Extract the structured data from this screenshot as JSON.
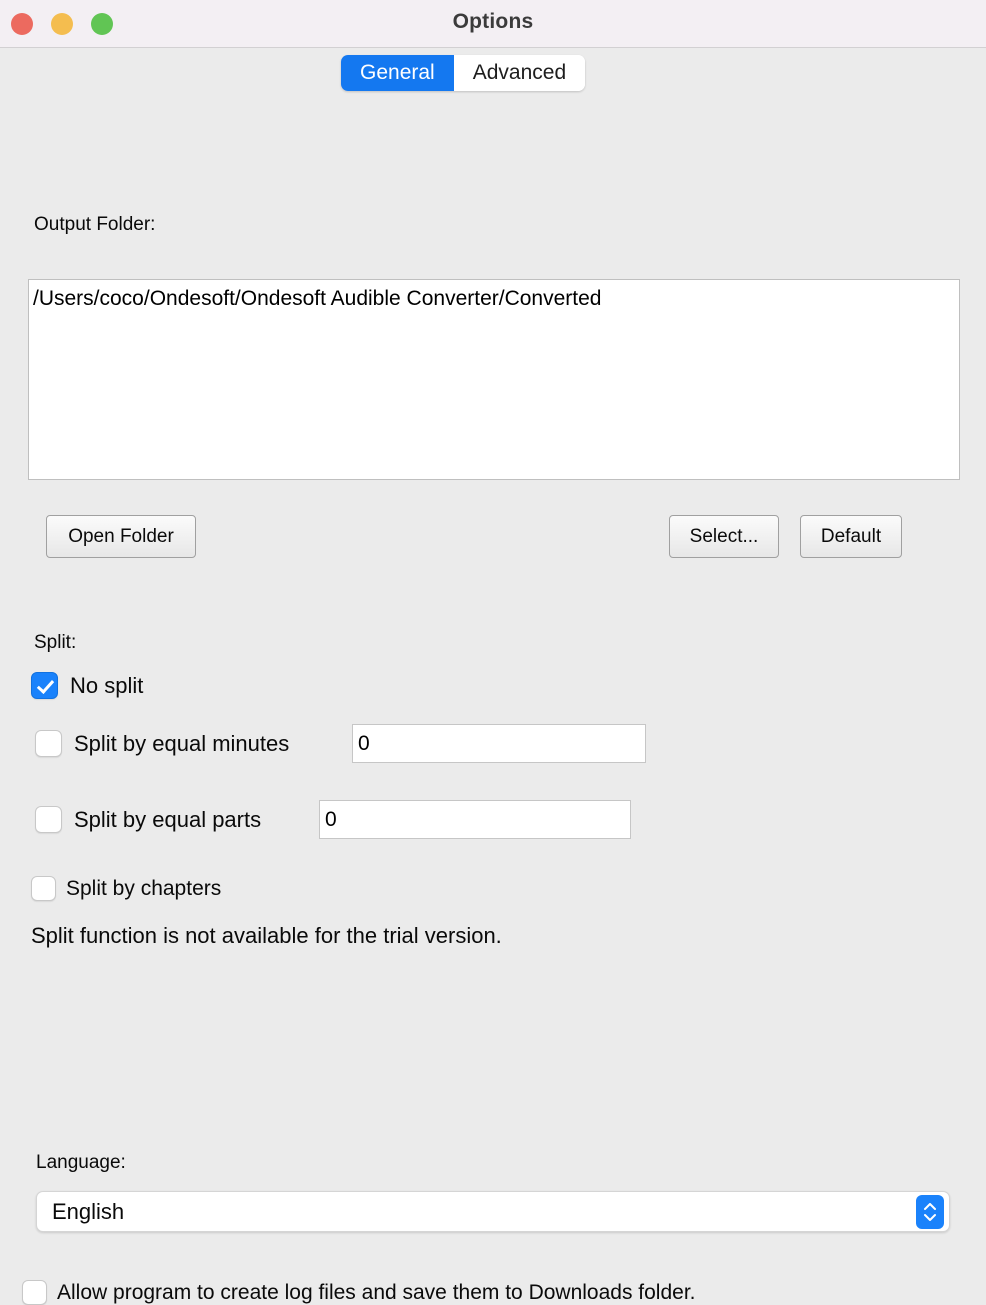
{
  "window": {
    "title": "Options",
    "traffic_lights": [
      {
        "name": "close-button",
        "color": "#ec6a5f"
      },
      {
        "name": "minimize-button",
        "color": "#f4bd4f"
      },
      {
        "name": "zoom-button",
        "color": "#61c554"
      }
    ]
  },
  "tabs": {
    "selected": "General",
    "items": [
      {
        "label": "General"
      },
      {
        "label": "Advanced"
      }
    ],
    "accent_color": "#1478f0"
  },
  "output_folder": {
    "label": "Output Folder:",
    "path": "/Users/coco/Ondesoft/Ondesoft Audible Converter/Converted",
    "buttons": {
      "open_folder": "Open Folder",
      "select": "Select...",
      "default": "Default"
    }
  },
  "split": {
    "label": "Split:",
    "options": [
      {
        "label": "No split",
        "checked": true
      },
      {
        "label": "Split by equal minutes",
        "checked": false,
        "value": "0"
      },
      {
        "label": "Split by equal parts",
        "checked": false,
        "value": "0"
      },
      {
        "label": "Split by chapters",
        "checked": false
      }
    ],
    "note": "Split function is not available for the trial version."
  },
  "language": {
    "label": "Language:",
    "selected": "English",
    "stepper_icon": "chevron-up-down-icon",
    "stepper_color": "#1a82fb"
  },
  "logging": {
    "label": "Allow program to create log files and save them to Downloads folder.",
    "checked": false
  }
}
